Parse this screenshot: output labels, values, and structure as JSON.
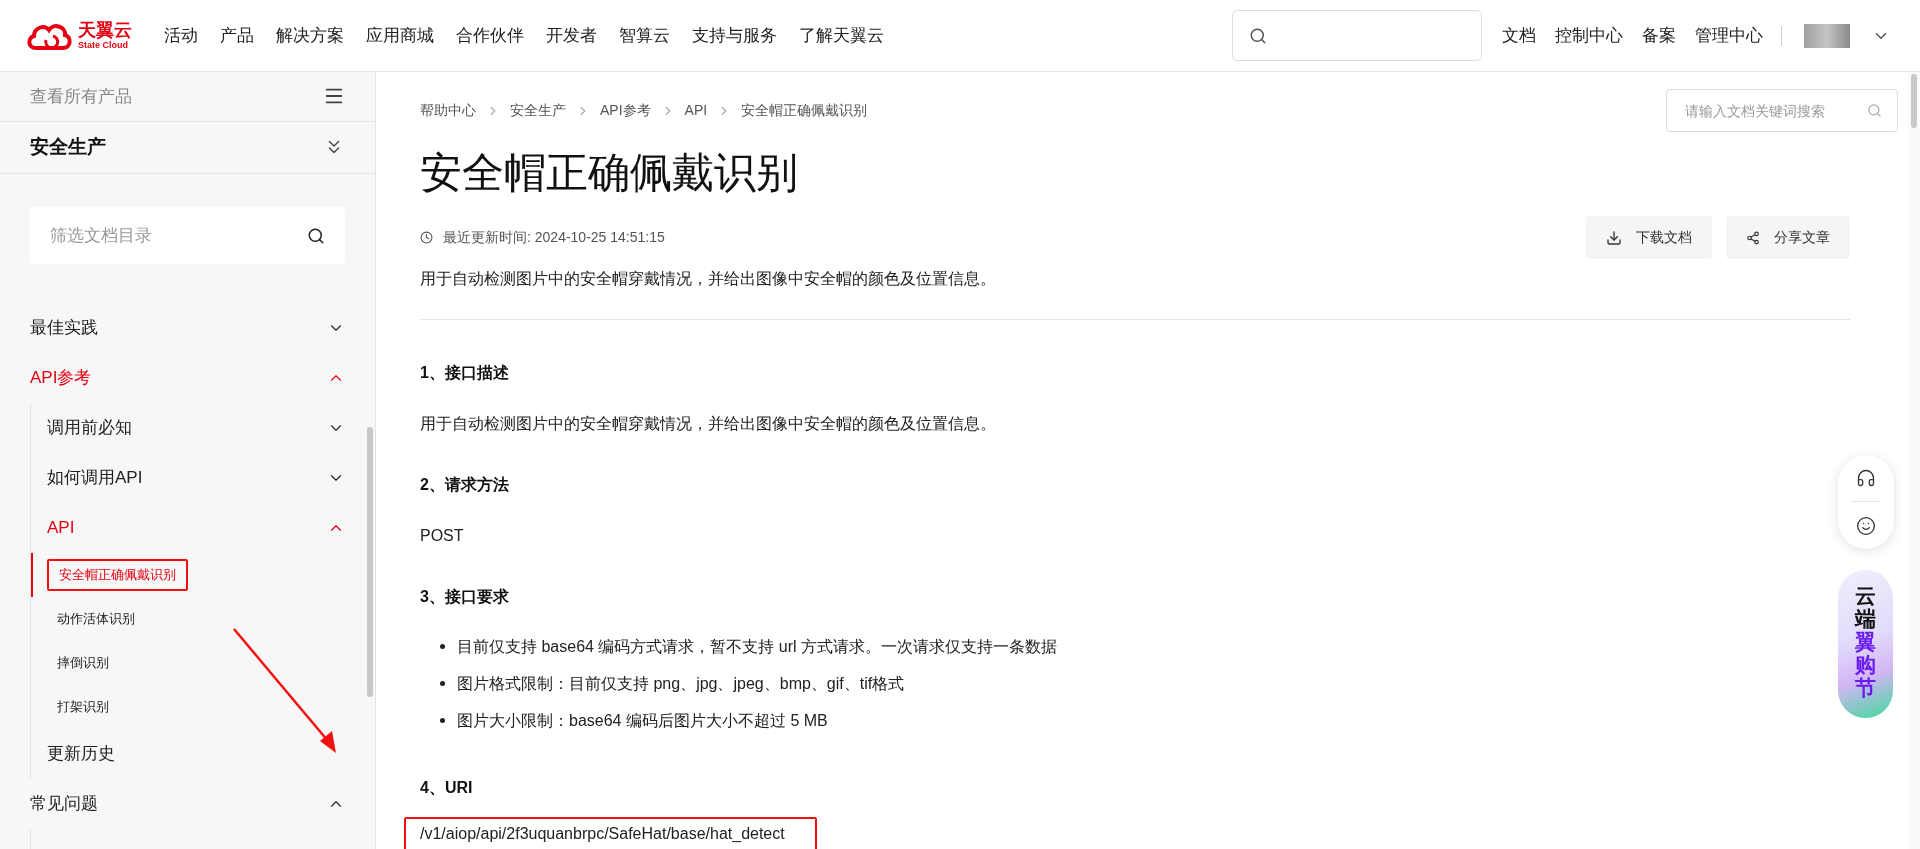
{
  "header": {
    "logo": {
      "name": "天翼云",
      "subtitle": "State Cloud"
    },
    "nav": [
      "活动",
      "产品",
      "解决方案",
      "应用商城",
      "合作伙伴",
      "开发者",
      "智算云",
      "支持与服务",
      "了解天翼云"
    ],
    "links": [
      "文档",
      "控制中心",
      "备案",
      "管理中心"
    ]
  },
  "sidebar": {
    "all_products": "查看所有产品",
    "product": "安全生产",
    "filter": {
      "placeholder": "筛选文档目录"
    },
    "items": [
      {
        "label": "最佳实践",
        "leaf": false,
        "expanded": false,
        "active": false
      },
      {
        "label": "API参考",
        "leaf": false,
        "expanded": true,
        "active": true,
        "children": [
          {
            "label": "调用前必知",
            "leaf": false,
            "expanded": false,
            "active": false
          },
          {
            "label": "如何调用API",
            "leaf": false,
            "expanded": false,
            "active": false
          },
          {
            "label": "API",
            "leaf": false,
            "expanded": true,
            "active": true,
            "children": [
              {
                "label": "安全帽正确佩戴识别",
                "selected": true,
                "annotated": true
              },
              {
                "label": "动作活体识别",
                "selected": false,
                "annotated": false
              },
              {
                "label": "摔倒识别",
                "selected": false,
                "annotated": false
              },
              {
                "label": "打架识别",
                "selected": false,
                "annotated": false
              }
            ]
          },
          {
            "label": "更新历史",
            "leaf": true,
            "expanded": false,
            "active": false
          }
        ]
      },
      {
        "label": "常见问题",
        "leaf": false,
        "expanded": true,
        "active": false
      }
    ]
  },
  "breadcrumb": [
    "帮助中心",
    "安全生产",
    "API参考",
    "API",
    "安全帽正确佩戴识别"
  ],
  "doc_search": {
    "placeholder": "请输入文档关键词搜索"
  },
  "title": "安全帽正确佩戴识别",
  "updated": "最近更新时间: 2024-10-25 14:51:15",
  "actions": [
    {
      "kind": "download",
      "label": "下载文档"
    },
    {
      "kind": "share",
      "label": "分享文章"
    }
  ],
  "summary": "用于自动检测图片中的安全帽穿戴情况，并给出图像中安全帽的颜色及位置信息。",
  "sections": [
    {
      "heading": "1、接口描述",
      "kind": "text",
      "text": "用于自动检测图片中的安全帽穿戴情况，并给出图像中安全帽的颜色及位置信息。"
    },
    {
      "heading": "2、请求方法",
      "kind": "text",
      "text": "POST"
    },
    {
      "heading": "3、接口要求",
      "kind": "list",
      "items": [
        "目前仅支持 base64 编码方式请求，暂不支持 url 方式请求。一次请求仅支持一条数据",
        "图片格式限制：目前仅支持 png、jpg、jpeg、bmp、gif、tif格式",
        "图片大小限制：base64 编码后图片大小不超过 5 MB"
      ]
    },
    {
      "heading": "4、URI",
      "kind": "uri",
      "text": "/v1/aiop/api/2f3uquanbrpc/SafeHat/base/hat_detect",
      "annotated": true
    }
  ],
  "promo": {
    "line_1": "云端",
    "line_2": "翼购节"
  }
}
